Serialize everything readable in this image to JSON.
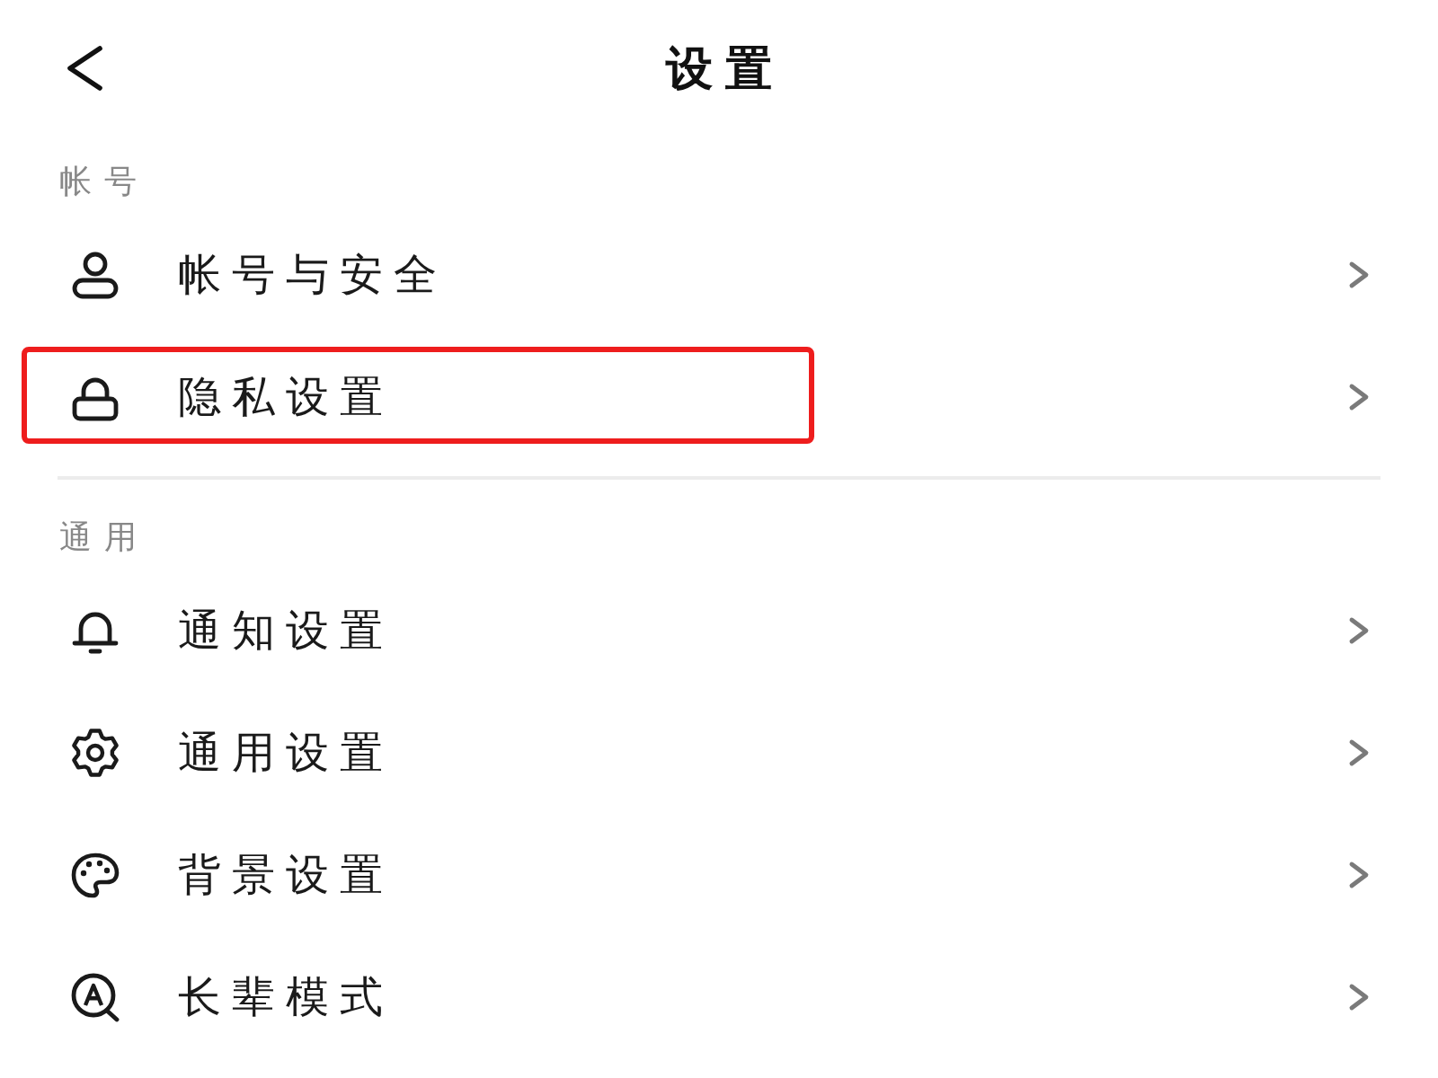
{
  "header": {
    "title": "设置"
  },
  "sections": [
    {
      "label": "帐号",
      "items": [
        {
          "kind": "account",
          "label": "帐号与安全",
          "highlighted": false
        },
        {
          "kind": "privacy",
          "label": "隐私设置",
          "highlighted": true
        }
      ]
    },
    {
      "label": "通用",
      "items": [
        {
          "kind": "notification",
          "label": "通知设置",
          "highlighted": false
        },
        {
          "kind": "general",
          "label": "通用设置",
          "highlighted": false
        },
        {
          "kind": "background",
          "label": "背景设置",
          "highlighted": false
        },
        {
          "kind": "elder",
          "label": "长辈模式",
          "highlighted": false
        }
      ]
    }
  ]
}
